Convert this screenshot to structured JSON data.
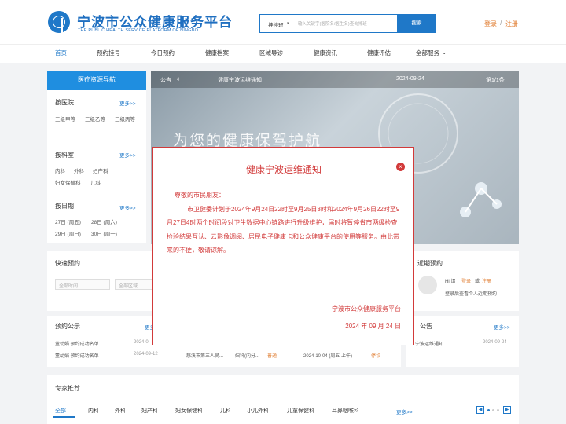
{
  "header": {
    "title_cn": "宁波市公众健康服务平台",
    "title_en": "THE PUBLIC HEALTH SERVICE PLATFORM OF NINGBO",
    "search_select": "挂排班",
    "search_placeholder": "输入关键字(医院名/医生名)查询排班",
    "search_button": "搜索",
    "login": "登录",
    "separator": "/",
    "register": "注册"
  },
  "nav": [
    "首页",
    "预约挂号",
    "今日预约",
    "健康档案",
    "区域导诊",
    "健康资讯",
    "健康评估",
    "全部服务"
  ],
  "sidebar": {
    "head": "医疗资源导航",
    "hospital_title": "按医院",
    "hospital_tags": [
      "三级甲等",
      "三级乙等",
      "三级丙等"
    ],
    "dept_title": "按科室",
    "dept_tags": [
      "内科",
      "外科",
      "妇产科",
      "妇女保健科",
      "儿科"
    ],
    "date_title": "按日期",
    "date_tags": [
      "27日 (周五)",
      "28日 (周六)",
      "29日 (周日)",
      "30日 (周一)"
    ],
    "more": "更多>>"
  },
  "notice": {
    "label": "公告",
    "text": "健康宁波运维通知",
    "date": "2024-09-24",
    "page": "第1/1条"
  },
  "banner_text": "为您的健康保驾护航",
  "quick": {
    "title": "快速预约",
    "time_placeholder": "全部时间",
    "area_placeholder": "全部区域"
  },
  "recent": {
    "title": "近期预约",
    "hi": "Hi!请",
    "login": "登录",
    "or": "或",
    "register": "注册",
    "tip": "登录后查看个人近期预约"
  },
  "public": {
    "title": "预约公示",
    "more": "更多",
    "rows": [
      {
        "name": "董幼娟 预约成功名单",
        "date": "2024-0"
      },
      {
        "name": "董幼娟 预约成功名单",
        "date": "2024-09-12"
      }
    ],
    "detail": {
      "hospital": "慈溪市第三人民...",
      "dept": "妇科(内分...",
      "type": "普通",
      "time": "2024-10-04 (周五 上午)",
      "status": "停诊"
    }
  },
  "bulletin": {
    "title": "公告",
    "more": "更多>>",
    "item": "宁波运维通知",
    "date": "2024-09-24"
  },
  "experts": {
    "title": "专家推荐",
    "tabs": [
      "全部",
      "内科",
      "外科",
      "妇产科",
      "妇女保健科",
      "儿科",
      "小儿外科",
      "儿童保健科",
      "耳鼻咽喉科"
    ],
    "more": "更多>>"
  },
  "modal": {
    "title": "健康宁波运维通知",
    "greeting": "尊敬的市民朋友：",
    "body": "市卫健委计划于2024年9月24日22时至9月25日3时和2024年9月26日22时至9月27日4时两个时间段对卫生数据中心链路进行升级维护，届时将暂停省市两级检查检验结果互认、云影像调阅、居民电子健康卡和公众健康平台的使用等服务。由此带来的不便，敬请谅解。",
    "sign": "宁波市公众健康服务平台",
    "date": "2024 年 09 月 24 日"
  }
}
